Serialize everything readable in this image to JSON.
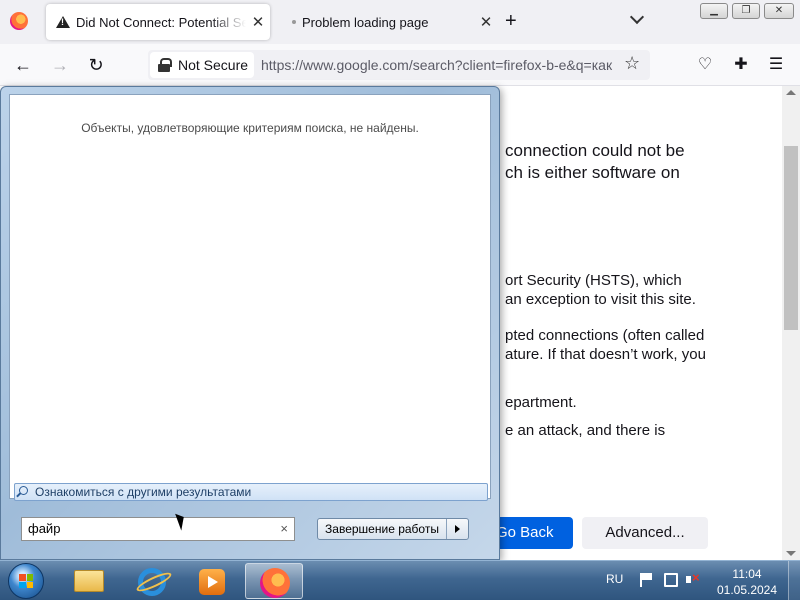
{
  "tabs": [
    {
      "title": "Did Not Connect: Potential Security Issue",
      "active": true
    },
    {
      "title": "Problem loading page",
      "active": false
    }
  ],
  "navbar": {
    "security_label": "Not Secure",
    "url": "https://www.google.com/search?client=firefox-b-e&q=как"
  },
  "error_page": {
    "line1": "connection could not be",
    "line2": "ch is either software on",
    "para1_line1": "ort Security (HSTS), which",
    "para1_line2": "an exception to visit this site.",
    "para2_line1": "pted connections (often called",
    "para2_line2": "ature. If that doesn’t work, you",
    "para3_line1": "epartment.",
    "para4_line1": "e an attack, and there is",
    "go_back_label": "Go Back",
    "advanced_label": "Advanced..."
  },
  "start_menu": {
    "no_results_text": "Объекты, удовлетворяющие критериям поиска, не найдены.",
    "see_more_label": "Ознакомиться с другими результатами",
    "search_value": "файр",
    "clear_symbol": "×",
    "shutdown_label": "Завершение работы"
  },
  "taskbar": {
    "language": "RU",
    "time": "11:04",
    "date": "01.05.2024",
    "pinned": [
      "folder-icon",
      "internet-explorer-icon",
      "media-player-icon",
      "firefox-icon"
    ],
    "active_app": "firefox-icon"
  },
  "colors": {
    "accent": "#0061e0",
    "start_menu_bg": "#bcd3ea",
    "taskbar": "#3f6690"
  }
}
